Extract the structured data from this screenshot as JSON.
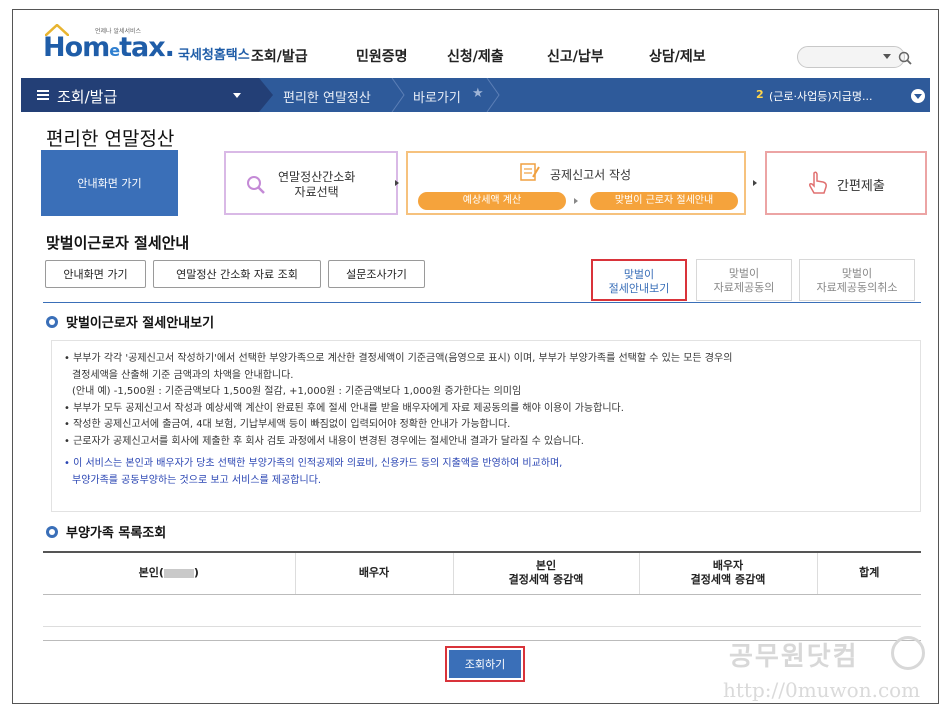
{
  "header": {
    "logo_text_main": "Hom",
    "logo_text_e": "e",
    "logo_text_tail": "tax.",
    "logo_small": "언제나 알세서비스",
    "logo_kor": "국세청홈택스",
    "gnb": [
      "조회/발급",
      "민원증명",
      "신청/제출",
      "신고/납부",
      "상담/제보"
    ]
  },
  "navbar": {
    "home": "조회/발급",
    "crumb1": "편리한 연말정산",
    "crumb2": "바로가기",
    "notice_num": "2",
    "notice_text": "(근로·사업등)지급명..."
  },
  "page": {
    "title": "편리한 연말정산",
    "sub_title": "맞벌이근로자 절세안내"
  },
  "steps": {
    "guide": "안내화면 가기",
    "step1": [
      "연말정산간소화",
      "자료선택"
    ],
    "step2": "공제신고서 작성",
    "step2_pill1": "예상세액 계산",
    "step2_pill2": "맞벌이 근로자 절세안내",
    "step3": "간편제출"
  },
  "buttons": {
    "guide": "안내화면 가기",
    "simple": "연말정산 간소화 자료 조회",
    "survey": "설문조사가기"
  },
  "tabs": [
    [
      "맞벌이",
      "절세안내보기"
    ],
    [
      "맞벌이",
      "자료제공동의"
    ],
    [
      "맞벌이",
      "자료제공동의취소"
    ]
  ],
  "section1": {
    "title": "맞벌이근로자 절세안내보기",
    "lines": [
      "• 부부가 각각 '공제신고서 작성하기'에서 선택한 부양가족으로 계산한 결정세액이 기준금액(음영으로 표시) 이며, 부부가 부양가족를 선택할 수 있는 모든 경우의",
      "결정세액을 산출해 기준 금액과의 차액을 안내합니다.",
      "(안내 예) -1,500원 : 기준금액보다 1,500원 절감, +1,000원 : 기준금액보다 1,000원 증가한다는 의미임",
      "• 부부가 모두 공제신고서 작성과 예상세액 계산이 완료된 후에 절세 안내를 받을 배우자에게 자료 제공동의를 해야 이용이 가능합니다.",
      "• 작성한 공제신고서에 출금여, 4대 보험, 기납부세액 등이 빠짐없이 입력되어야 정확한 안내가 가능합니다.",
      "• 근로자가 공제신고서를 회사에 제출한 후 회사 검토 과정에서 내용이 변경된 경우에는 절세안내 결과가 달라질 수 있습니다."
    ],
    "blue_lines": [
      "• 이 서비스는 본인과 배우자가 당초 선택한 부양가족의 인적공제와 의료비, 신용카드 등의 지출액을 반영하여 비교하며,",
      "부양가족를 공동부양하는 것으로 보고 서비스를 제공합니다."
    ]
  },
  "section2": {
    "title": "부양가족 목록조회",
    "columns": {
      "self_prefix": "본인(",
      "self_suffix": ")",
      "spouse": "배우자",
      "self_tax": [
        "본인",
        "결정세액 증감액"
      ],
      "spouse_tax": [
        "배우자",
        "결정세액 증감액"
      ],
      "total": "합계"
    }
  },
  "query_button": "조회하기",
  "watermark": {
    "text": "공무원닷컴",
    "url": "http://0muwon.com",
    "circle_text": "㉧"
  },
  "colors": {
    "brand_blue": "#2e5a9a",
    "accent_orange": "#f5a33c",
    "highlight_red": "#d9333a"
  }
}
